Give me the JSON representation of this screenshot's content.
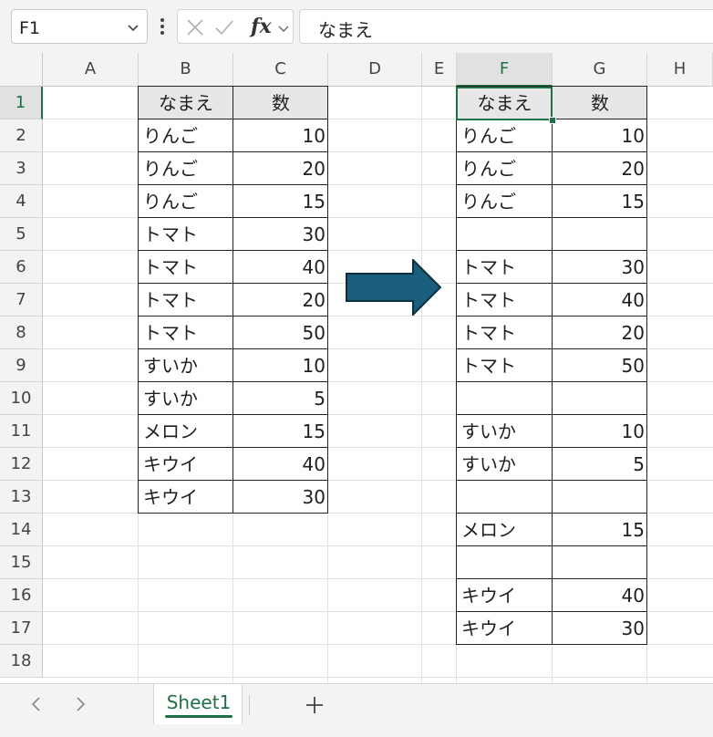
{
  "formula_bar": {
    "name_box": "F1",
    "fx_label": "fx",
    "content": "なまえ"
  },
  "columns": [
    "A",
    "B",
    "C",
    "D",
    "E",
    "F",
    "G",
    "H"
  ],
  "rows": [
    "1",
    "2",
    "3",
    "4",
    "5",
    "6",
    "7",
    "8",
    "9",
    "10",
    "11",
    "12",
    "13",
    "14",
    "15",
    "16",
    "17",
    "18"
  ],
  "source_table": {
    "headers": [
      "なまえ",
      "数"
    ],
    "rows": [
      [
        "りんご",
        "10"
      ],
      [
        "りんご",
        "20"
      ],
      [
        "りんご",
        "15"
      ],
      [
        "トマト",
        "30"
      ],
      [
        "トマト",
        "40"
      ],
      [
        "トマト",
        "20"
      ],
      [
        "トマト",
        "50"
      ],
      [
        "すいか",
        "10"
      ],
      [
        "すいか",
        "5"
      ],
      [
        "メロン",
        "15"
      ],
      [
        "キウイ",
        "40"
      ],
      [
        "キウイ",
        "30"
      ]
    ]
  },
  "result_table": {
    "headers": [
      "なまえ",
      "数"
    ],
    "rows": [
      [
        "りんご",
        "10"
      ],
      [
        "りんご",
        "20"
      ],
      [
        "りんご",
        "15"
      ],
      [
        "",
        ""
      ],
      [
        "トマト",
        "30"
      ],
      [
        "トマト",
        "40"
      ],
      [
        "トマト",
        "20"
      ],
      [
        "トマト",
        "50"
      ],
      [
        "",
        ""
      ],
      [
        "すいか",
        "10"
      ],
      [
        "すいか",
        "5"
      ],
      [
        "",
        ""
      ],
      [
        "メロン",
        "15"
      ],
      [
        "",
        ""
      ],
      [
        "キウイ",
        "40"
      ],
      [
        "キウイ",
        "30"
      ]
    ]
  },
  "arrow_color": "#1a5e7d",
  "accent_color": "#1e7145",
  "sheet_tabs": {
    "active": "Sheet1"
  }
}
